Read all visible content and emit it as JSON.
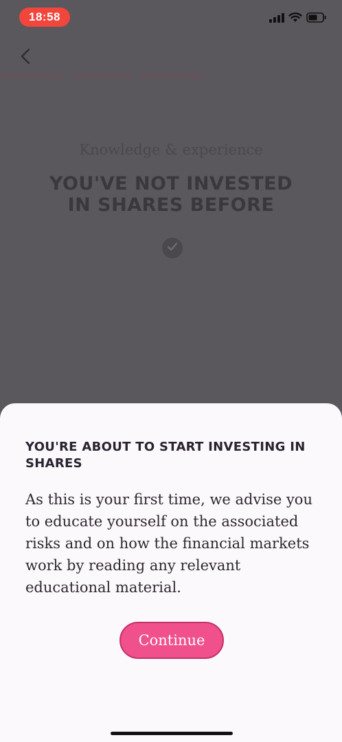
{
  "status_bar": {
    "time": "18:58",
    "icons": [
      "signal-icon",
      "wifi-icon",
      "battery-icon"
    ]
  },
  "nav": {
    "back_icon": "chevron-left-icon",
    "progress": {
      "total_steps": 5,
      "completed_steps": 3,
      "color": "#7a4a55"
    }
  },
  "background": {
    "subtitle": "Knowledge & experience",
    "headline": "YOU'VE NOT INVESTED IN SHARES BEFORE",
    "check_icon": "checkmark-icon"
  },
  "sheet": {
    "title": "YOU'RE ABOUT TO START INVESTING IN SHARES",
    "body": "As this is your first time, we advise you to educate yourself on the associated risks and on how the financial markets work by reading any relevant educational material.",
    "continue_label": "Continue",
    "accent_color": "#f0508c"
  }
}
